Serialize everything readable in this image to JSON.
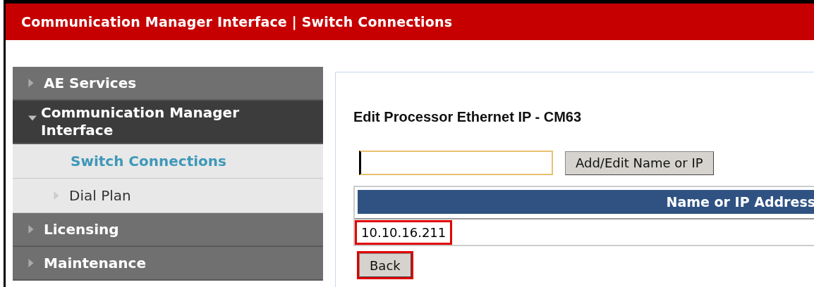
{
  "header": {
    "title": "Communication Manager Interface | Switch Connections"
  },
  "sidebar": {
    "items": [
      {
        "label": "AE Services",
        "expanded": false,
        "selected": false
      },
      {
        "label": "Communication Manager Interface",
        "expanded": true,
        "selected": false,
        "children": [
          {
            "label": "Switch Connections",
            "selected": true
          },
          {
            "label": "Dial Plan",
            "selected": false,
            "expanded": false
          }
        ]
      },
      {
        "label": "Licensing",
        "expanded": false,
        "selected": false
      },
      {
        "label": "Maintenance",
        "expanded": false,
        "selected": false
      }
    ]
  },
  "content": {
    "heading": "Edit Processor Ethernet IP - CM63",
    "name_field": {
      "focused": true
    },
    "add_button": {
      "label": "Add/Edit Name or IP"
    },
    "table": {
      "columns": [
        "Name or IP Address"
      ],
      "rows": [
        {
          "value": "10.10.16.211",
          "highlighted": true
        }
      ]
    },
    "back_button": {
      "label": "Back",
      "highlighted": true
    }
  }
}
